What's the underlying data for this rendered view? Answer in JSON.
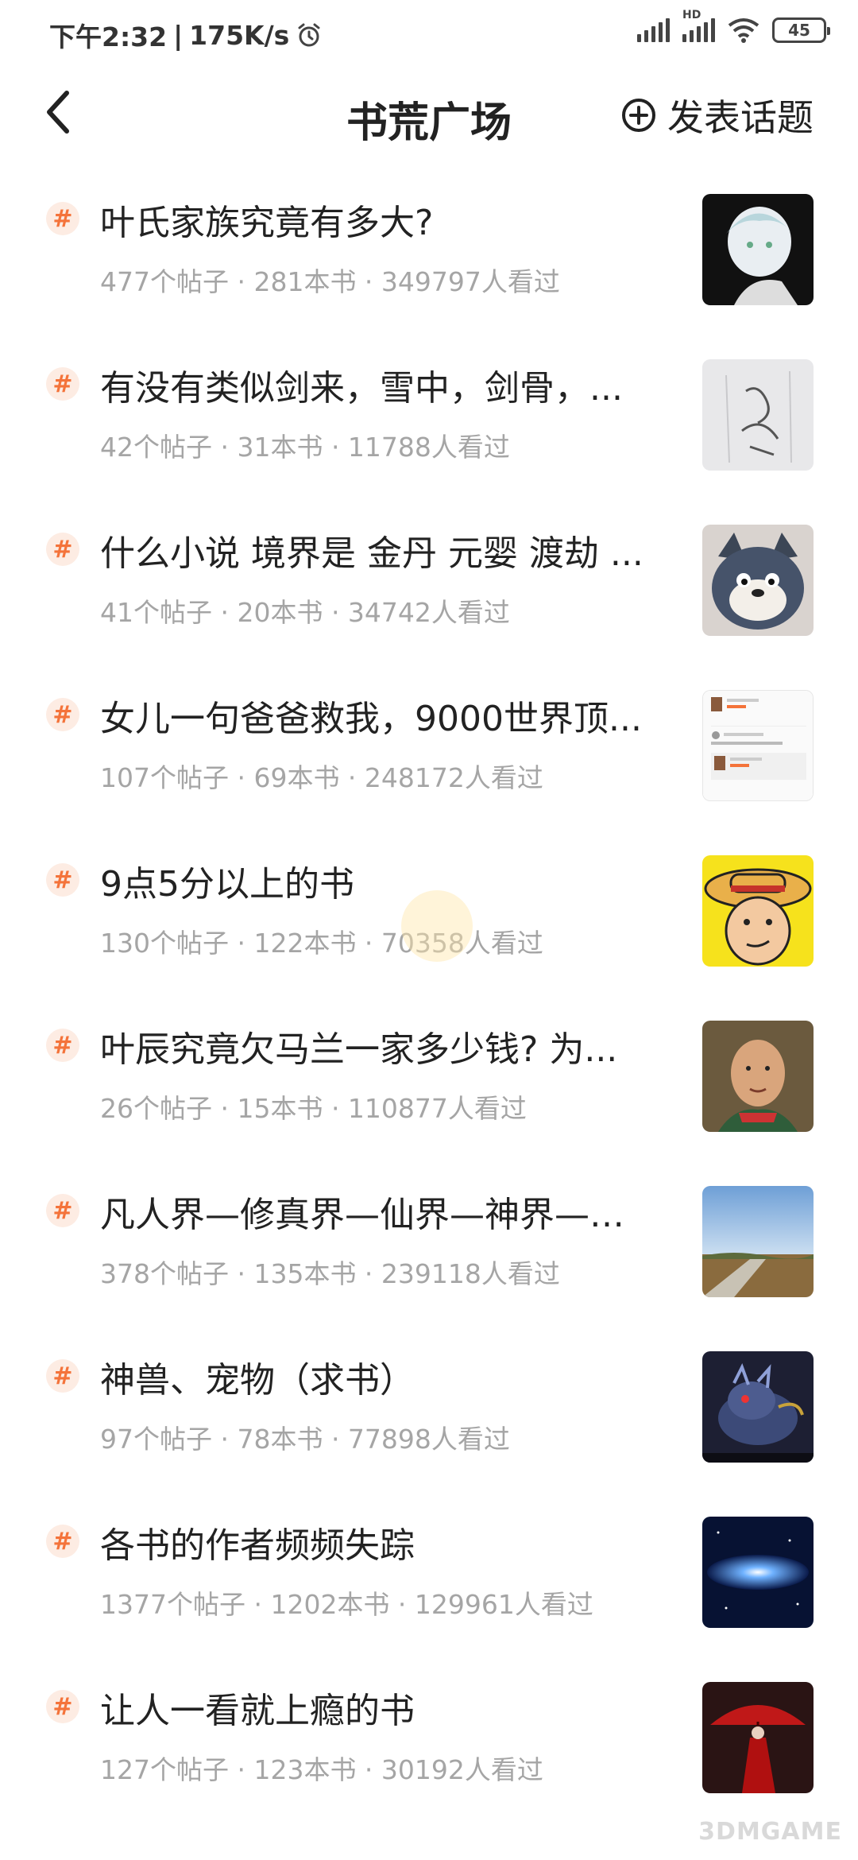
{
  "status_bar": {
    "time": "下午2:32",
    "net_speed": "175K/s",
    "hd_label": "HD",
    "battery": "45"
  },
  "nav": {
    "title": "书荒广场",
    "post_topic_label": "发表话题"
  },
  "topics": [
    {
      "hash": "#",
      "title": "叶氏家族究竟有多大?",
      "stats": "477个帖子 · 281本书 · 349797人看过",
      "thumb_icon": "anime-avatar-thumbnail"
    },
    {
      "hash": "#",
      "title": "有没有类似剑来，雪中，剑骨，...",
      "stats": "42个帖子 · 31本书 · 11788人看过",
      "thumb_icon": "handwriting-photo-thumbnail"
    },
    {
      "hash": "#",
      "title": "什么小说 境界是 金丹 元婴 渡劫 ...",
      "stats": "41个帖子 · 20本书 · 34742人看过",
      "thumb_icon": "cartoon-cat-thumbnail"
    },
    {
      "hash": "#",
      "title": "女儿一句爸爸救我，9000世界顶...",
      "stats": "107个帖子 · 69本书 · 248172人看过",
      "thumb_icon": "screenshot-thumbnail"
    },
    {
      "hash": "#",
      "title": "9点5分以上的书",
      "stats": "130个帖子 · 122本书 · 70358人看过",
      "thumb_icon": "straw-hat-cartoon-thumbnail"
    },
    {
      "hash": "#",
      "title": "叶辰究竟欠马兰一家多少钱? 为...",
      "stats": "26个帖子 · 15本书 · 110877人看过",
      "thumb_icon": "actor-photo-thumbnail"
    },
    {
      "hash": "#",
      "title": "凡人界—修真界—仙界—神界—圣...",
      "stats": "378个帖子 · 135本书 · 239118人看过",
      "thumb_icon": "landscape-photo-thumbnail"
    },
    {
      "hash": "#",
      "title": "神兽、宠物（求书）",
      "stats": "97个帖子 · 78本书 · 77898人看过",
      "thumb_icon": "beast-illustration-thumbnail"
    },
    {
      "hash": "#",
      "title": "各书的作者频频失踪",
      "stats": "1377个帖子 · 1202本书 · 129961人看过",
      "thumb_icon": "galaxy-thumbnail"
    },
    {
      "hash": "#",
      "title": "让人一看就上瘾的书",
      "stats": "127个帖子 · 123本书 · 30192人看过",
      "thumb_icon": "red-umbrella-thumbnail"
    }
  ],
  "watermark": "3DMGAME",
  "colors": {
    "accent": "#f4733a",
    "badge_bg": "#fdece3",
    "stats_text": "#a5a5a5",
    "title_text": "#222222"
  }
}
